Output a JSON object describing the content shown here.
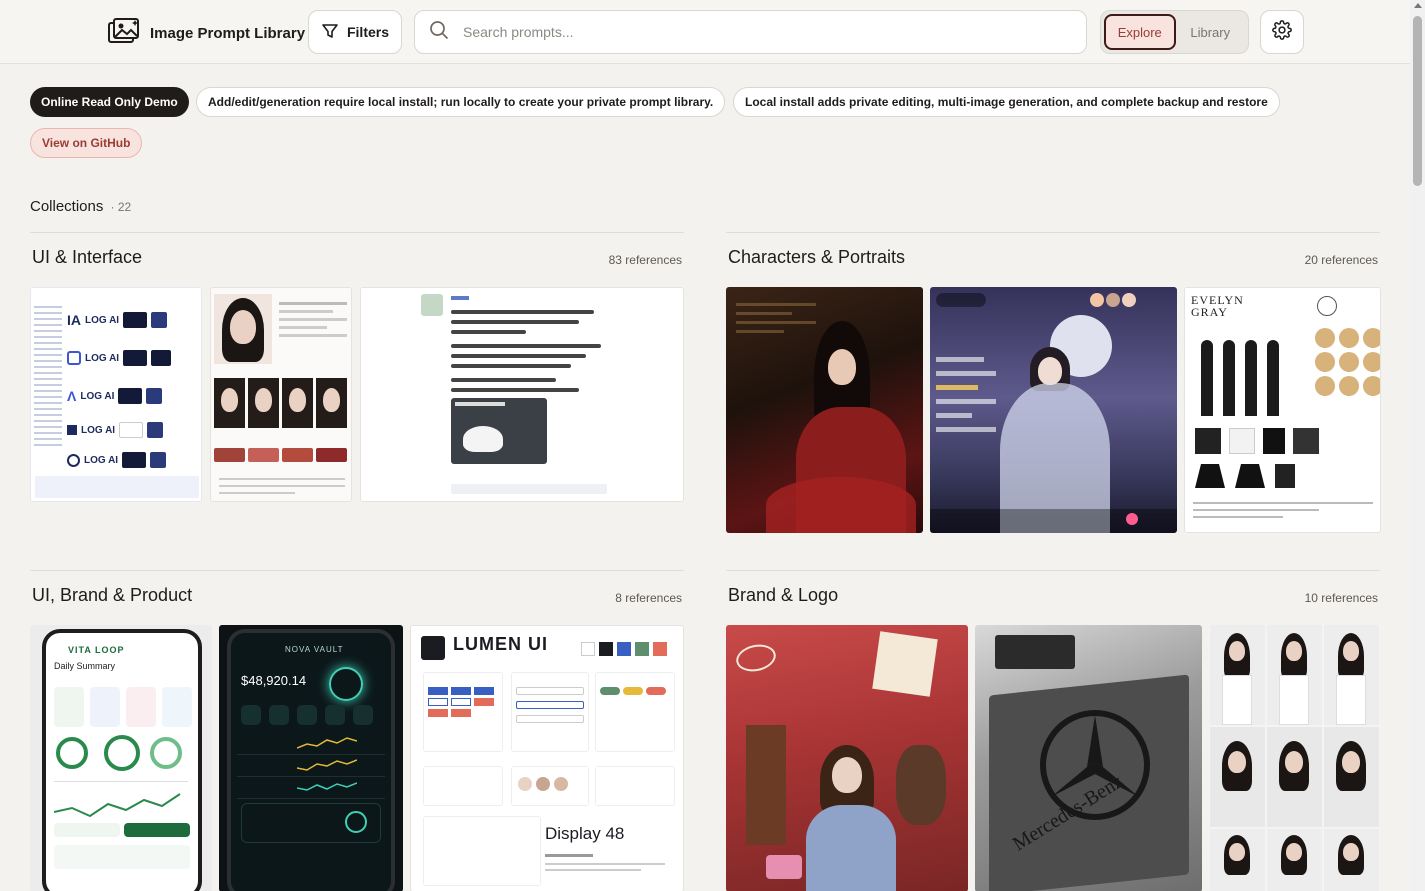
{
  "header": {
    "brand_title": "Image Prompt Library",
    "filters_label": "Filters",
    "search_placeholder": "Search prompts...",
    "tabs": [
      {
        "label": "Explore",
        "active": true
      },
      {
        "label": "Library",
        "active": false
      }
    ]
  },
  "banner": {
    "demo_label": "Online Read Only Demo",
    "notice_1": "Add/edit/generation require local install; run locally to create your private prompt library.",
    "notice_2": "Local install adds private editing, multi-image generation, and complete backup and restore",
    "github_label": "View on GitHub"
  },
  "collections": {
    "title": "Collections",
    "count_label": "· 22",
    "items": [
      {
        "title": "UI & Interface",
        "refs": "83 references"
      },
      {
        "title": "Characters & Portraits",
        "refs": "20 references"
      },
      {
        "title": "UI, Brand & Product",
        "refs": "8 references"
      },
      {
        "title": "Brand & Logo",
        "refs": "10 references"
      }
    ]
  },
  "thumb_text": {
    "log_ai": "LOG AI",
    "evelyn": "EVELYN GRAY",
    "vita_loop": "VITA LOOP",
    "daily_summary": "Daily Summary",
    "nova_vault": "NOVA VAULT",
    "portfolio_value": "$48,920.14",
    "lumen_ui": "LUMEN UI",
    "display_48": "Display 48",
    "mercedes": "Mercedes-Benz"
  },
  "colors": {
    "accent": "#9a3b34",
    "accent_bg": "#f8e3df",
    "dark": "#1f1c1a",
    "page_bg": "#f4f2ee"
  }
}
